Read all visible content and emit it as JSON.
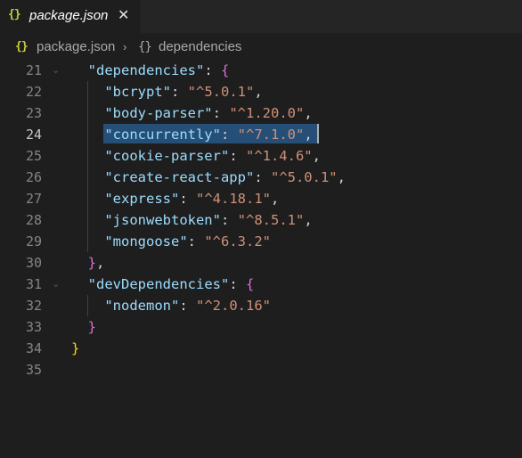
{
  "tab": {
    "icon": "{}",
    "title": "package.json",
    "close": "✕"
  },
  "breadcrumb": {
    "icon": "{}",
    "file": "package.json",
    "separator": "›",
    "icon2": "{}",
    "node": "dependencies"
  },
  "editor": {
    "line_numbers": [
      "21",
      "22",
      "23",
      "24",
      "25",
      "26",
      "27",
      "28",
      "29",
      "30",
      "31",
      "32",
      "33",
      "34",
      "35"
    ],
    "active_line": "24",
    "dependencies_key": "\"dependencies\"",
    "devDependencies_key": "\"devDependencies\"",
    "deps": [
      {
        "name": "\"bcrypt\"",
        "version": "\"^5.0.1\"",
        "sep": ","
      },
      {
        "name": "\"body-parser\"",
        "version": "\"^1.20.0\"",
        "sep": ","
      },
      {
        "name": "\"concurrently\"",
        "version": "\"^7.1.0\"",
        "sep": ","
      },
      {
        "name": "\"cookie-parser\"",
        "version": "\"^1.4.6\"",
        "sep": ","
      },
      {
        "name": "\"create-react-app\"",
        "version": "\"^5.0.1\"",
        "sep": ","
      },
      {
        "name": "\"express\"",
        "version": "\"^4.18.1\"",
        "sep": ","
      },
      {
        "name": "\"jsonwebtoken\"",
        "version": "\"^8.5.1\"",
        "sep": ","
      },
      {
        "name": "\"mongoose\"",
        "version": "\"^6.3.2\"",
        "sep": ""
      }
    ],
    "devDeps": [
      {
        "name": "\"nodemon\"",
        "version": "\"^2.0.16\"",
        "sep": ""
      }
    ],
    "colon": ": ",
    "open_brace": "{",
    "close_brace": "}",
    "close_brace_comma": "},",
    "fold_icon": "⌄"
  },
  "colors": {
    "background": "#1e1e1e",
    "key": "#9cdcfe",
    "string": "#ce9178",
    "bracket_level1": "#ffd700",
    "bracket_level2": "#da70d6",
    "selection": "#264f78"
  }
}
